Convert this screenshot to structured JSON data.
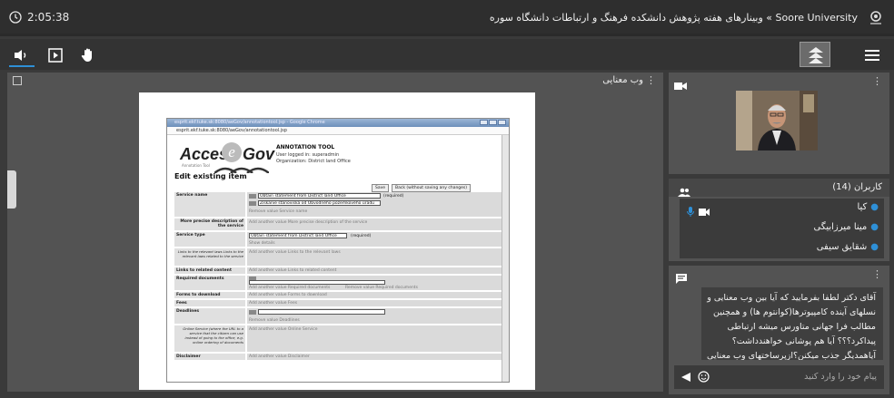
{
  "header": {
    "clock": "2:05:38",
    "title": "Soore University » وبینارهای هفته پژوهش دانشکده فرهنگ و ارتباطات دانشگاه سوره"
  },
  "toolbar": {
    "icons": [
      "speaker-icon",
      "play-frame-icon",
      "hand-icon",
      "logo-badge",
      "menu-icon"
    ]
  },
  "presentation": {
    "title": "وب معنایی",
    "slide": {
      "window_title": "esprit.ekf.tuke.sk:8080/aeGov/annotationtool.jsp - Google Chrome",
      "address": "esprit.ekf.tuke.sk:8080/aeGov/annotationtool.jsp",
      "logo_access": "Access",
      "logo_e": "e",
      "logo_gov": "Gov",
      "logo_tag": "Annotation Tool",
      "tool_title": "ANNOTATION TOOL",
      "user_line": "User logged in: superadmin",
      "org_line": "Organization: District land Office",
      "edit_title": "Edit existing item",
      "save_btn": "Save",
      "back_btn": "Back (without saving any changes)",
      "rows": {
        "service_name": "Service name",
        "service_name_en": "Obtain statement from District land Office",
        "service_name_sk": "Získanie stanoviska od Obvodného pozemkového úradu",
        "required": "(required)",
        "remove_name": "Remove value Service name",
        "precise_desc": "More precise description of the service",
        "add_precise": "Add another value More precise description of the service",
        "service_type": "Service type",
        "service_type_val": "Obtain statement from District land Office",
        "show_details": "Show details",
        "links_relevant": "Links to the relevant laws Links to the relevant laws related to the service",
        "add_links": "Add another value Links to the relevant laws",
        "links_related": "Links to related content",
        "add_related": "Add another value Links to related content",
        "required_docs": "Required documents",
        "add_docs": "Add another value Required documents",
        "remove_docs": "Remove value Required documents",
        "forms": "Forms to download",
        "add_forms": "Add another value Forms to download",
        "fees": "Fees",
        "add_fees": "Add another value Fees",
        "deadlines": "Deadlines",
        "remove_deadlines": "Remove value Deadlines",
        "online": "Online Service (where the URL to a service that the citizen can use instead of going to the office, e.g. online ordering of documents",
        "add_online": "Add another value Online Service",
        "disclaimer": "Disclaimer",
        "add_disclaimer": "Add another value Disclaimer"
      }
    }
  },
  "users": {
    "title": "کاربران (14)",
    "list": [
      "کیا",
      "مینا میرزابیگی",
      "شقایق سیفی"
    ]
  },
  "chat": {
    "message": "آقای دکتر لطفا بفرمایید که آیا بین وب معنایی و نسلهای آینده کامپیوترها(کوانتوم ها) و همچنین مطالب فرا جهانی متاورس میشه ارتباطی پیداکرد؟؟؟ آیا هم پوشانی خواهندداشت؟ آیاهمدیگر جذب میکنن؟ازپرساختهای وب معنایی",
    "placeholder": "پیام خود را وارد کنید"
  },
  "colors": {
    "accent": "#2e8fd6",
    "panel": "#535353",
    "background": "#3a3a3a"
  }
}
